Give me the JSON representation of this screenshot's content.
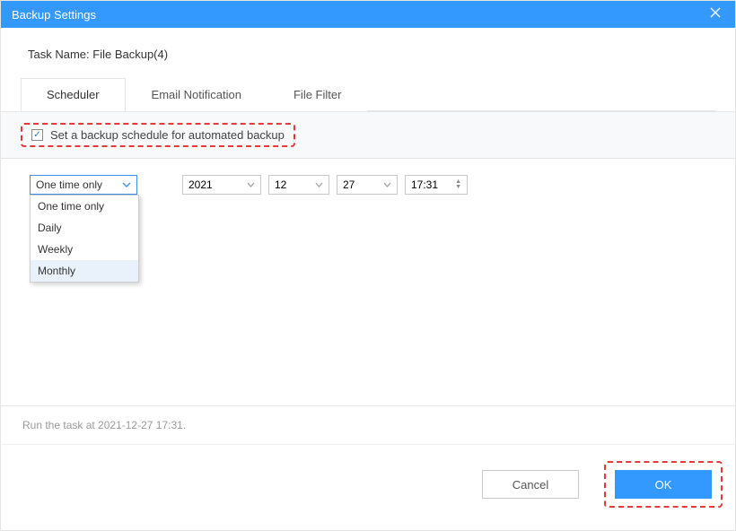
{
  "titlebar": {
    "title": "Backup Settings"
  },
  "task_name_label": "Task Name:",
  "task_name_value": "File Backup(4)",
  "tabs": [
    {
      "label": "Scheduler",
      "active": true
    },
    {
      "label": "Email Notification",
      "active": false
    },
    {
      "label": "File Filter",
      "active": false
    }
  ],
  "schedule_checkbox": {
    "checked": true,
    "label": "Set a backup schedule for automated backup"
  },
  "frequency": {
    "selected": "One time only",
    "options": [
      "One time only",
      "Daily",
      "Weekly",
      "Monthly"
    ],
    "hovered_index": 3
  },
  "date": {
    "year": "2021",
    "month": "12",
    "day": "27",
    "time": "17:31"
  },
  "footer_note": "Run the task at 2021-12-27 17:31.",
  "buttons": {
    "cancel": "Cancel",
    "ok": "OK"
  }
}
